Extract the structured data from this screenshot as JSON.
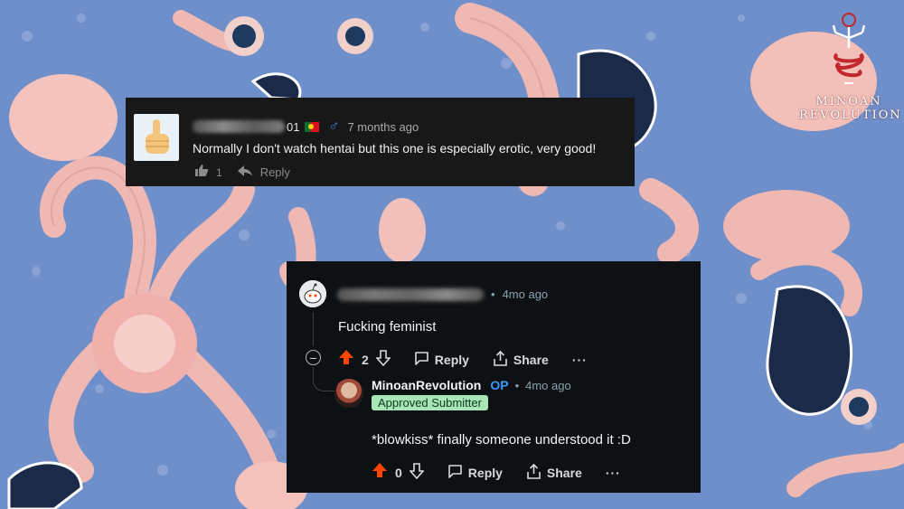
{
  "watermark": {
    "text_line1": "MINOAN",
    "text_line2": "REVOLUTION"
  },
  "youtube_comment": {
    "author_suffix": "01",
    "time": "7 months ago",
    "text": "Normally I don't watch hentai but this one is especially erotic, very good!",
    "likes": "1",
    "reply_label": "Reply",
    "icons": {
      "avatar": "middle-finger-emoji",
      "like": "thumbs-up-icon",
      "reply": "reply-arrow-icon",
      "gender": "male-symbol-icon"
    },
    "colors": {
      "background": "#181818",
      "gender": "#3f8cf4"
    }
  },
  "reddit_thread": {
    "colors": {
      "background": "#0e1113",
      "upvote": "#ff4500",
      "op": "#3d9bff",
      "badge_bg": "#a8e6b7"
    },
    "parent": {
      "time": "4mo ago",
      "text": "Fucking feminist",
      "score": "2",
      "reply_label": "Reply",
      "share_label": "Share",
      "more_label": "···",
      "collapse_label": "−"
    },
    "reply": {
      "username": "MinoanRevolution",
      "op_label": "OP",
      "time": "4mo ago",
      "flair": "Approved Submitter",
      "text": "*blowkiss* finally someone understood it :D",
      "score": "0",
      "reply_label": "Reply",
      "share_label": "Share",
      "more_label": "···"
    }
  }
}
